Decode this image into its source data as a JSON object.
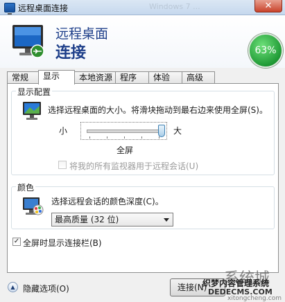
{
  "window": {
    "title": "远程桌面连接",
    "ghost_text": "Windows 7 ...",
    "close_glyph": "✕"
  },
  "header": {
    "title_line1": "远程桌面",
    "title_line2": "连接"
  },
  "progress": {
    "label": "63%",
    "value": 63
  },
  "tabs": [
    {
      "label": "常规"
    },
    {
      "label": "显示",
      "active": true
    },
    {
      "label": "本地资源"
    },
    {
      "label": "程序"
    },
    {
      "label": "体验"
    },
    {
      "label": "高级"
    }
  ],
  "display_config": {
    "group_label": "显示配置",
    "description": "选择远程桌面的大小。将滑块拖动到最右边来使用全屏(S)。",
    "slider_min_label": "小",
    "slider_max_label": "大",
    "slider_value_label": "全屏",
    "slider_level": 1.0,
    "multi_monitor_label": "将我的所有监视器用于远程会话(U)",
    "multi_monitor_checked": false,
    "multi_monitor_disabled": true
  },
  "colors": {
    "group_label": "颜色",
    "description": "选择远程会话的颜色深度(C)。",
    "selected_option": "最高质量 (32 位)"
  },
  "fullscreen_bar": {
    "label": "全屏时显示连接栏(B)",
    "checked": true,
    "check_glyph": "✓"
  },
  "footer": {
    "hide_options_label": "隐藏选项(O)",
    "connect_label": "连接(N)"
  },
  "watermark": {
    "brand": "系统城",
    "line1": "织梦内容管理系统",
    "line2": "DEDECMS.COM",
    "line3": "xitongcheng.com"
  },
  "icons": [
    "app-monitor-icon",
    "display-monitor-icon",
    "color-palette-icon",
    "chevron-up-icon"
  ],
  "accent_colors": {
    "title": "#1e3f8a",
    "progress": "#1f9a35",
    "close": "#c9432b"
  }
}
